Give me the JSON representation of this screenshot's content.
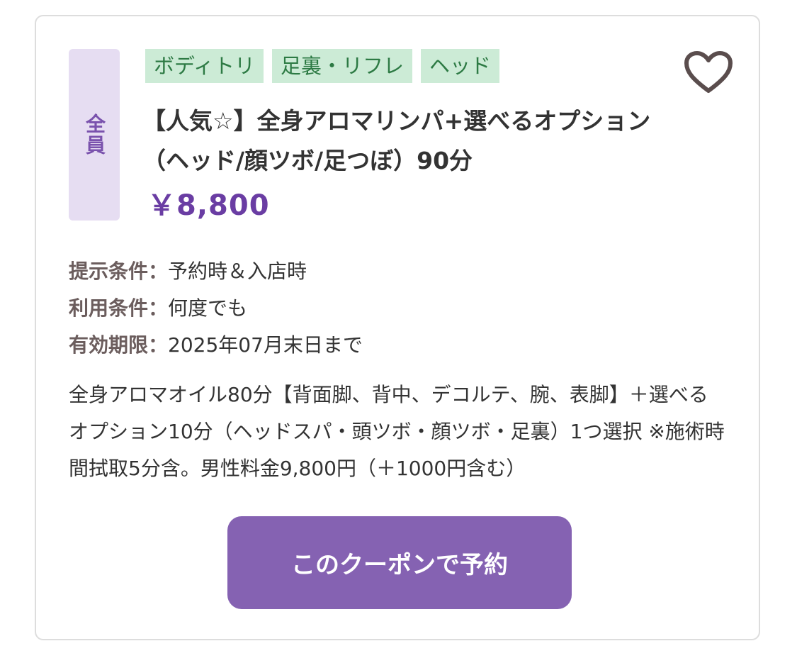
{
  "coupon": {
    "target_label": "全員",
    "tags": [
      "ボディトリ",
      "足裏・リフレ",
      "ヘッド"
    ],
    "favorite_icon": "heart-outline-icon",
    "title": "【人気☆】全身アロマリンパ+選べるオプション（ヘッド/顔ツボ/足つぼ）90分",
    "price": "￥8,800",
    "conditions": [
      {
        "label": "提示条件：",
        "value": "予約時＆入店時"
      },
      {
        "label": "利用条件：",
        "value": "何度でも"
      },
      {
        "label": "有効期限：",
        "value": "2025年07月末日まで"
      }
    ],
    "description": "全身アロマオイル80分【背面脚、背中、デコルテ、腕、表脚】＋選べるオプション10分（ヘッドスパ・頭ツボ・顔ツボ・足裏）1つ選択 ※施術時間拭取5分含。男性料金9,800円（＋1000円含む）",
    "reserve_button": "このクーポンで予約"
  },
  "colors": {
    "accent": "#8562b2",
    "price": "#6a3da3",
    "tag_background": "#ccebd6",
    "tag_text": "#2d7a44",
    "target_badge_background": "#e6ddf2",
    "target_badge_text": "#7a52ad"
  }
}
